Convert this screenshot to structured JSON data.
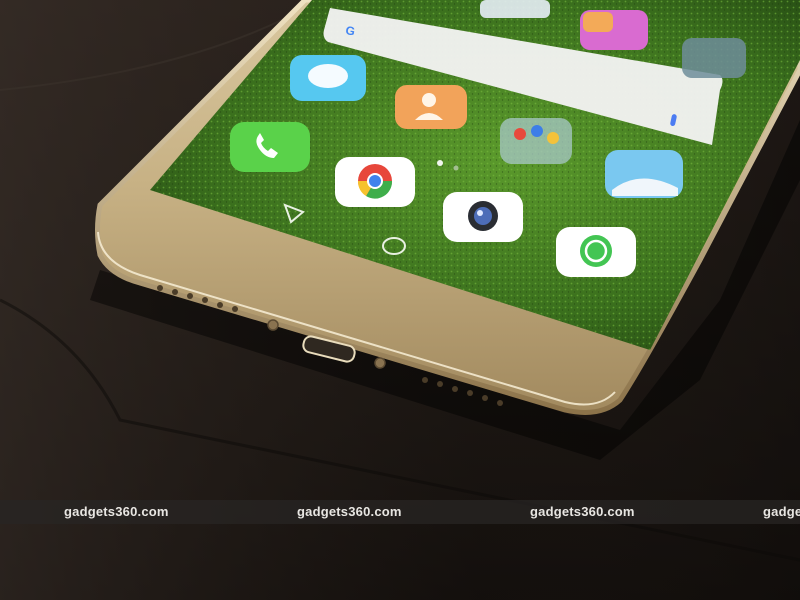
{
  "photo": {
    "subject": "smartphone",
    "body_color": "#c8b48a",
    "screen_wallpaper": "#3f7a22"
  },
  "home_screen": {
    "apps": [
      {
        "label": "Messaging",
        "icon": "messaging-icon",
        "color": "#56c8f0"
      },
      {
        "label": "Contacts",
        "icon": "contacts-icon",
        "color": "#f2a35a"
      },
      {
        "label": "Phone",
        "icon": "phone-icon",
        "color": "#5ad24a"
      },
      {
        "label": "Chrome",
        "icon": "chrome-icon",
        "color": "#ffffff"
      },
      {
        "label": "Google",
        "icon": "google-folder-icon",
        "color": "#7fa8b8"
      },
      {
        "label": "Gallery",
        "icon": "gallery-icon",
        "color": "#7ac8f0"
      },
      {
        "label": "Camera",
        "icon": "camera-icon",
        "color": "#ffffff"
      },
      {
        "label": "WhatsApp",
        "icon": "whatsapp-icon",
        "color": "#43c553"
      }
    ],
    "nav_buttons": [
      "back-icon",
      "home-icon",
      "recents-icon"
    ]
  },
  "watermark": {
    "text": "gadgets360.com"
  }
}
